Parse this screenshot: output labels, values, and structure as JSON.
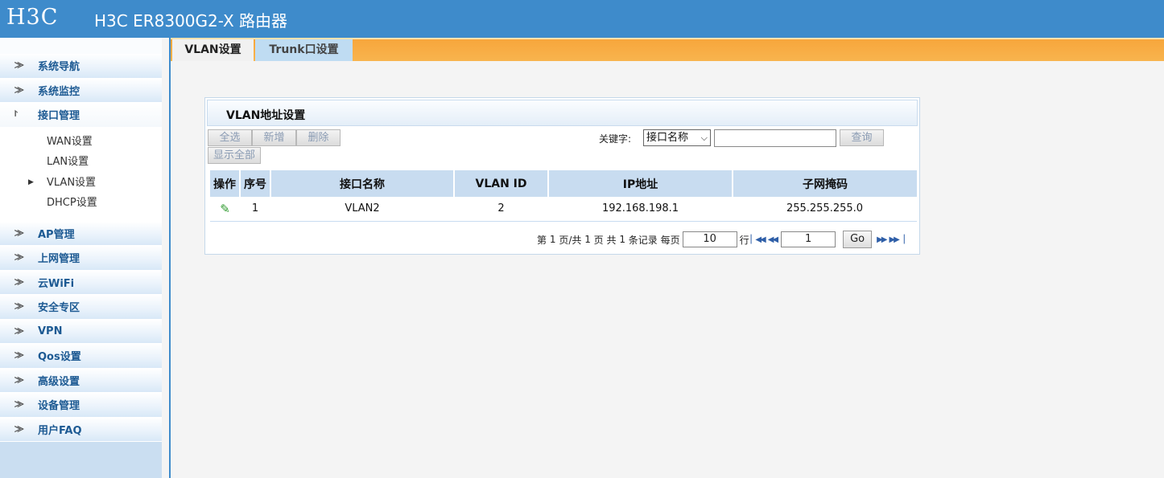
{
  "header": {
    "logo": "H3C",
    "title": "H3C ER8300G2-X 路由器"
  },
  "sidebar": {
    "items": [
      {
        "label": "系统导航"
      },
      {
        "label": "系统监控"
      },
      {
        "label": "接口管理",
        "open": true,
        "sub": [
          {
            "label": "WAN设置"
          },
          {
            "label": "LAN设置"
          },
          {
            "label": "VLAN设置",
            "selected": true
          },
          {
            "label": "DHCP设置"
          }
        ]
      },
      {
        "label": "AP管理"
      },
      {
        "label": "上网管理"
      },
      {
        "label": "云WiFi"
      },
      {
        "label": "安全专区"
      },
      {
        "label": "VPN"
      },
      {
        "label": "Qos设置"
      },
      {
        "label": "高级设置"
      },
      {
        "label": "设备管理"
      },
      {
        "label": "用户FAQ"
      }
    ]
  },
  "tabs": [
    {
      "label": "VLAN设置",
      "active": true
    },
    {
      "label": "Trunk口设置",
      "active": false
    }
  ],
  "panel": {
    "title": "VLAN地址设置",
    "buttons": {
      "select_all": "全选",
      "add": "新增",
      "delete": "删除",
      "show_all": "显示全部",
      "query": "查询"
    },
    "search": {
      "label": "关键字:",
      "field": "接口名称",
      "value": ""
    },
    "table": {
      "headers": [
        "操作",
        "序号",
        "接口名称",
        "VLAN ID",
        "IP地址",
        "子网掩码"
      ],
      "rows": [
        {
          "index": "1",
          "name": "VLAN2",
          "vlan_id": "2",
          "ip": "192.168.198.1",
          "mask": "255.255.255.0"
        }
      ]
    },
    "pager": {
      "text_page": "第",
      "current_page": "1",
      "text_total_pages": "页/共",
      "total_pages": "1",
      "text_pages_total": "页 共",
      "total_records": "1",
      "text_records_per_page": "条记录 每页",
      "per_page": "10",
      "text_rows": "行",
      "goto_page": "1",
      "go_label": "Go"
    }
  },
  "colors": {
    "header": "#3e8bcb",
    "tabbar": "#f7a63c",
    "table_header": "#c8dcf0"
  }
}
